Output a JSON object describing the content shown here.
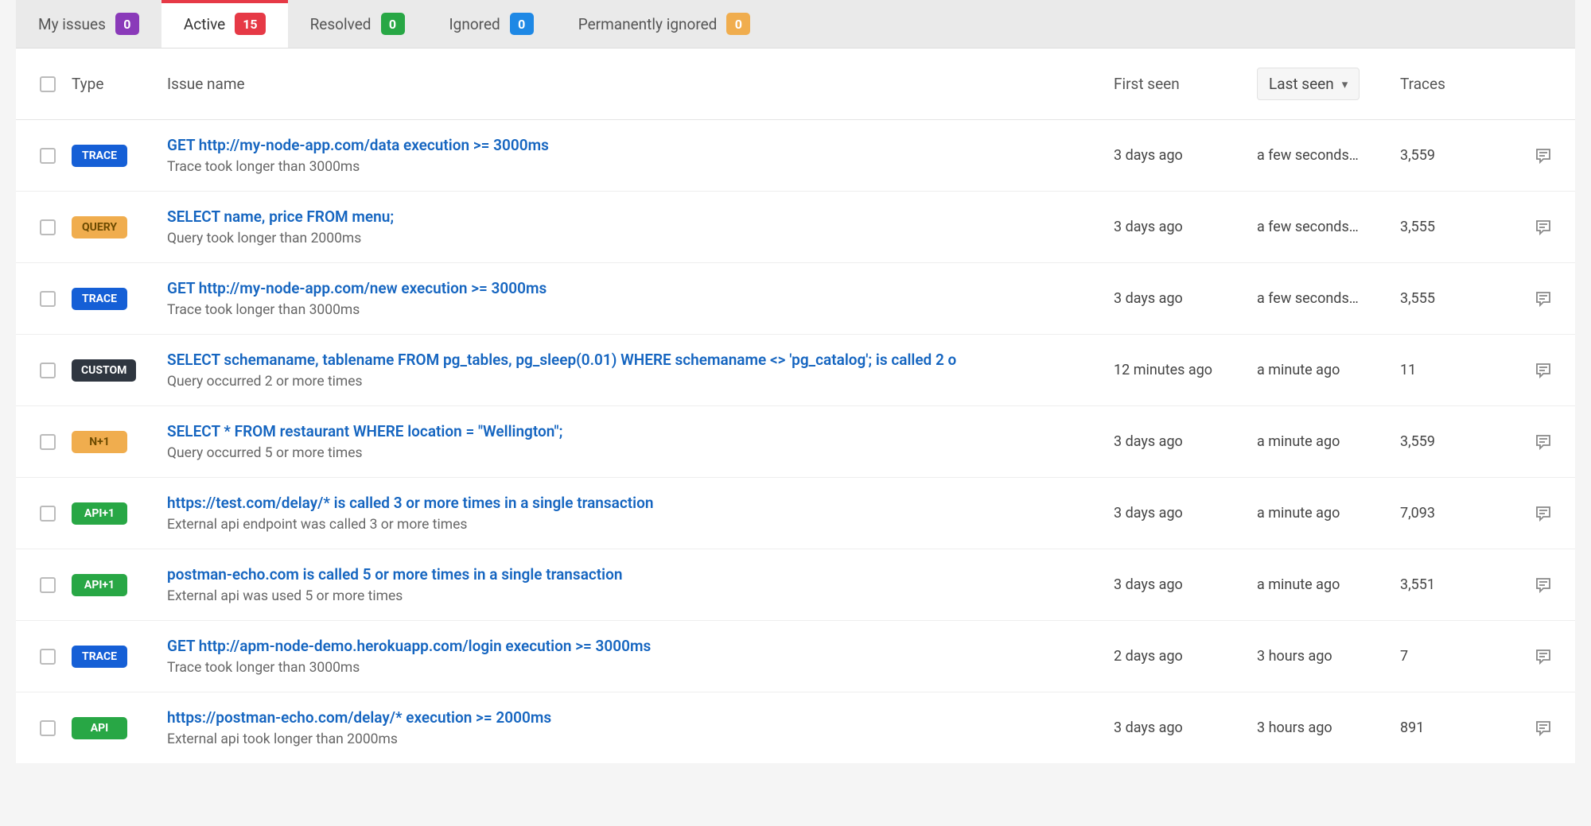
{
  "tabs": [
    {
      "label": "My issues",
      "count": "0",
      "color": "purple",
      "active": false
    },
    {
      "label": "Active",
      "count": "15",
      "color": "red",
      "active": true
    },
    {
      "label": "Resolved",
      "count": "0",
      "color": "green",
      "active": false
    },
    {
      "label": "Ignored",
      "count": "0",
      "color": "blue",
      "active": false
    },
    {
      "label": "Permanently ignored",
      "count": "0",
      "color": "orange",
      "active": false
    }
  ],
  "columns": {
    "type": "Type",
    "issue_name": "Issue name",
    "first_seen": "First seen",
    "last_seen": "Last seen",
    "traces": "Traces"
  },
  "issues": [
    {
      "type_label": "TRACE",
      "type_class": "pill-trace",
      "title": "GET http://my-node-app.com/data execution >= 3000ms",
      "sub": "Trace took longer than 3000ms",
      "first_seen": "3 days ago",
      "last_seen": "a few seconds…",
      "traces": "3,559"
    },
    {
      "type_label": "QUERY",
      "type_class": "pill-query",
      "title": "SELECT name, price FROM menu;",
      "sub": "Query took longer than 2000ms",
      "first_seen": "3 days ago",
      "last_seen": "a few seconds…",
      "traces": "3,555"
    },
    {
      "type_label": "TRACE",
      "type_class": "pill-trace",
      "title": "GET http://my-node-app.com/new execution >= 3000ms",
      "sub": "Trace took longer than 3000ms",
      "first_seen": "3 days ago",
      "last_seen": "a few seconds…",
      "traces": "3,555"
    },
    {
      "type_label": "CUSTOM",
      "type_class": "pill-custom",
      "title": "SELECT schemaname, tablename FROM pg_tables, pg_sleep(0.01) WHERE schemaname <> 'pg_catalog'; is called 2 o",
      "sub": "Query occurred 2 or more times",
      "first_seen": "12 minutes ago",
      "last_seen": "a minute ago",
      "traces": "11"
    },
    {
      "type_label": "N+1",
      "type_class": "pill-n1",
      "title": "SELECT * FROM restaurant WHERE location = \"Wellington\";",
      "sub": "Query occurred 5 or more times",
      "first_seen": "3 days ago",
      "last_seen": "a minute ago",
      "traces": "3,559"
    },
    {
      "type_label": "API+1",
      "type_class": "pill-api1",
      "title": "https://test.com/delay/* is called 3 or more times in a single transaction",
      "sub": "External api endpoint was called 3 or more times",
      "first_seen": "3 days ago",
      "last_seen": "a minute ago",
      "traces": "7,093"
    },
    {
      "type_label": "API+1",
      "type_class": "pill-api1",
      "title": "postman-echo.com is called 5 or more times in a single transaction",
      "sub": "External api was used 5 or more times",
      "first_seen": "3 days ago",
      "last_seen": "a minute ago",
      "traces": "3,551"
    },
    {
      "type_label": "TRACE",
      "type_class": "pill-trace",
      "title": "GET http://apm-node-demo.herokuapp.com/login execution >= 3000ms",
      "sub": "Trace took longer than 3000ms",
      "first_seen": "2 days ago",
      "last_seen": "3 hours ago",
      "traces": "7"
    },
    {
      "type_label": "API",
      "type_class": "pill-api",
      "title": "https://postman-echo.com/delay/* execution >= 2000ms",
      "sub": "External api took longer than 2000ms",
      "first_seen": "3 days ago",
      "last_seen": "3 hours ago",
      "traces": "891"
    }
  ]
}
